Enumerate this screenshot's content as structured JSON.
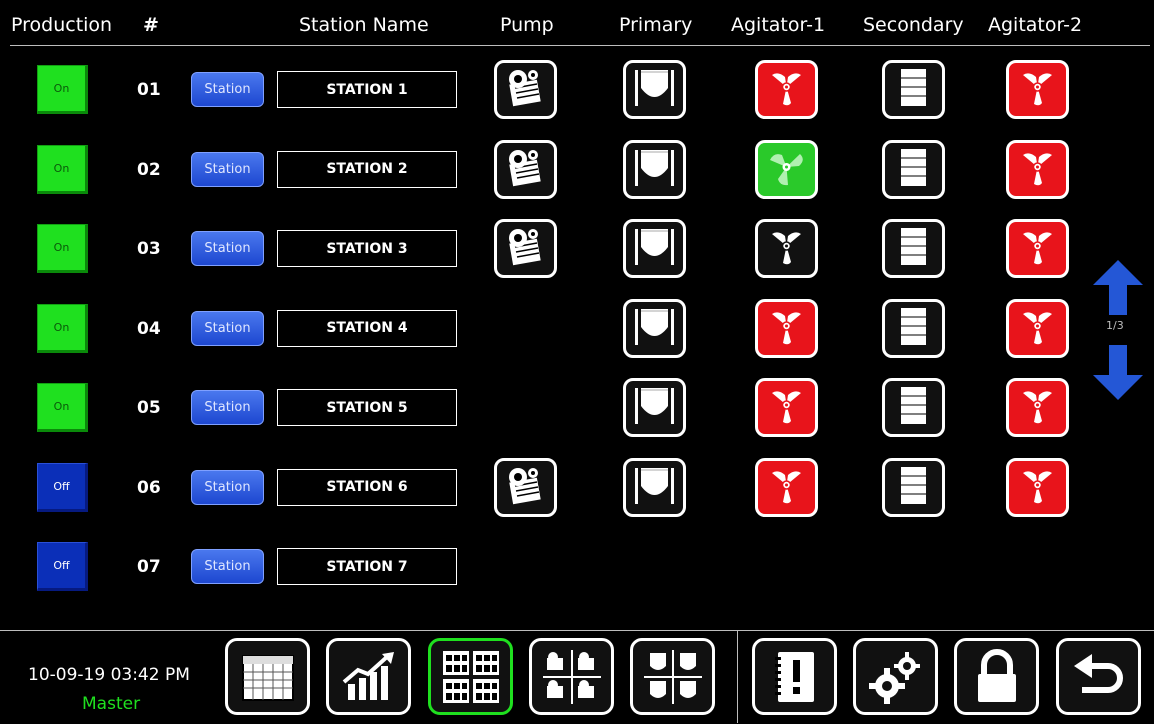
{
  "header": {
    "production": "Production",
    "number": "#",
    "station_name": "Station Name",
    "pump": "Pump",
    "primary": "Primary",
    "agitator1": "Agitator-1",
    "secondary": "Secondary",
    "agitator2": "Agitator-2"
  },
  "rows": [
    {
      "production": "On",
      "number": "01",
      "station_button": "Station",
      "name": "STATION 1",
      "pump": true,
      "primary": true,
      "agitator1": "red",
      "secondary": true,
      "agitator2": "red"
    },
    {
      "production": "On",
      "number": "02",
      "station_button": "Station",
      "name": "STATION 2",
      "pump": true,
      "primary": true,
      "agitator1": "green",
      "secondary": true,
      "agitator2": "red"
    },
    {
      "production": "On",
      "number": "03",
      "station_button": "Station",
      "name": "STATION 3",
      "pump": true,
      "primary": true,
      "agitator1": "black",
      "secondary": true,
      "agitator2": "red"
    },
    {
      "production": "On",
      "number": "04",
      "station_button": "Station",
      "name": "STATION 4",
      "pump": false,
      "primary": true,
      "agitator1": "red",
      "secondary": true,
      "agitator2": "red"
    },
    {
      "production": "On",
      "number": "05",
      "station_button": "Station",
      "name": "STATION 5",
      "pump": false,
      "primary": true,
      "agitator1": "red",
      "secondary": true,
      "agitator2": "red"
    },
    {
      "production": "Off",
      "number": "06",
      "station_button": "Station",
      "name": "STATION 6",
      "pump": true,
      "primary": true,
      "agitator1": "red",
      "secondary": true,
      "agitator2": "red"
    },
    {
      "production": "Off",
      "number": "07",
      "station_button": "Station",
      "name": "STATION 7",
      "pump": false,
      "primary": false,
      "agitator1": null,
      "secondary": false,
      "agitator2": null
    }
  ],
  "pager": {
    "label": "1/3"
  },
  "footer": {
    "datetime": "10-09-19 03:42 PM",
    "user": "Master",
    "buttons": [
      "calendar-icon",
      "trend-chart-icon",
      "station-grid-icon",
      "pump-grid-icon",
      "tank-grid-icon",
      "alarm-book-icon",
      "settings-gears-icon",
      "lock-icon",
      "back-arrow-icon"
    ]
  },
  "colors": {
    "on": "#1fe01f",
    "off": "#0b2fb8",
    "agitator_stopped": "#e8141b",
    "agitator_running": "#2ac92a",
    "station_button": "#1d47d0"
  }
}
